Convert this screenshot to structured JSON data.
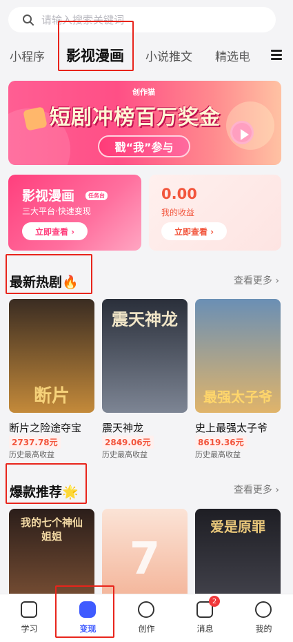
{
  "search": {
    "placeholder": "请输入搜索关键词"
  },
  "tabs": [
    {
      "label": "小程序"
    },
    {
      "label": "影视漫画",
      "active": true
    },
    {
      "label": "小说推文"
    },
    {
      "label": "精选电"
    }
  ],
  "banner": {
    "brand": "创作猫",
    "headline": "短剧冲榜百万奖金",
    "cta": "戳“我”参与"
  },
  "task_card": {
    "title": "影视漫画",
    "badge": "任务台",
    "subtitle": "三大平台·快速变现",
    "button": "立即查看 ›"
  },
  "earnings_card": {
    "amount": "0.00",
    "label": "我的收益",
    "button": "立即查看 ›"
  },
  "hot_section": {
    "title": "最新热剧🔥",
    "more": "查看更多 ›",
    "items": [
      {
        "name": "断片之险途夺宝",
        "earning": "2737.78元",
        "label": "历史最高收益",
        "poster_text": "断片",
        "colors": [
          "#3a2c22",
          "#c48a3a"
        ]
      },
      {
        "name": "震天神龙",
        "earning": "2849.06元",
        "label": "历史最高收益",
        "poster_text": "震天神龙",
        "colors": [
          "#2a2f3a",
          "#7d8594"
        ]
      },
      {
        "name": "史上最强太子爷",
        "earning": "8619.36元",
        "label": "历史最高收益",
        "poster_text": "最强太子爷",
        "colors": [
          "#6a8fb5",
          "#e0b46a"
        ]
      }
    ]
  },
  "recommend_section": {
    "title": "爆款推荐🌟",
    "more": "查看更多 ›",
    "items": [
      {
        "poster_text": "我的七个神仙姐姐",
        "colors": [
          "#2b1e1a",
          "#8a5a3a"
        ]
      },
      {
        "poster_text": "7",
        "colors": [
          "#fbe3d6",
          "#f2a98a"
        ]
      },
      {
        "poster_text": "爱是原罪",
        "colors": [
          "#1e1e24",
          "#4b4b55"
        ]
      }
    ]
  },
  "bottom_nav": [
    {
      "label": "学习",
      "icon": "book-icon"
    },
    {
      "label": "变现",
      "icon": "diamond-icon",
      "active": true
    },
    {
      "label": "创作",
      "icon": "plus-icon"
    },
    {
      "label": "消息",
      "icon": "mail-icon",
      "badge": "2"
    },
    {
      "label": "我的",
      "icon": "profile-icon"
    }
  ],
  "colors": {
    "accent": "#3f5bff",
    "pink": "#ff3f7d",
    "earning": "#f2553c",
    "highlight_box": "#e8241b"
  }
}
